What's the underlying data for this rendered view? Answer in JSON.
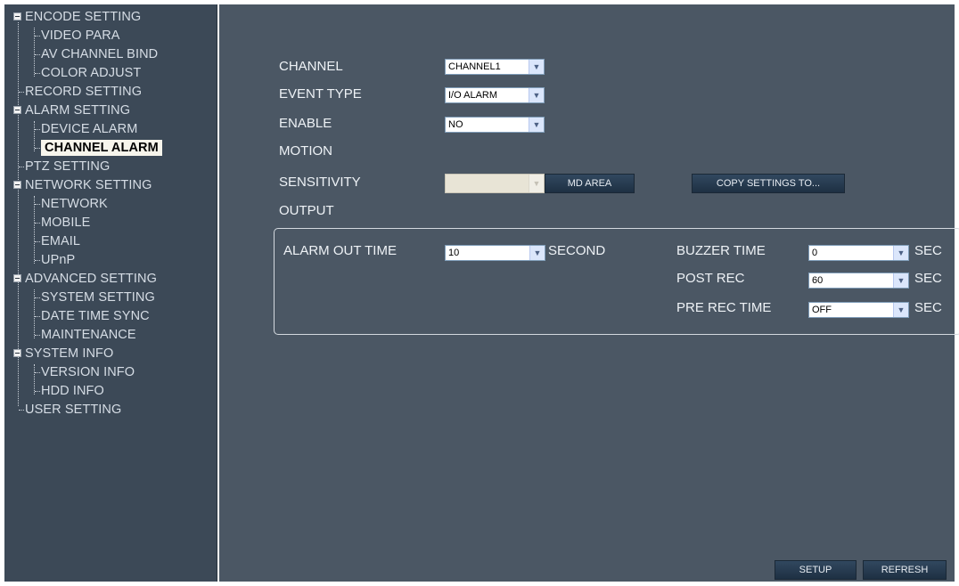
{
  "tree": {
    "items": [
      {
        "label": "ENCODE SETTING"
      },
      {
        "label": "VIDEO PARA"
      },
      {
        "label": "AV CHANNEL BIND"
      },
      {
        "label": "COLOR ADJUST"
      },
      {
        "label": "RECORD SETTING"
      },
      {
        "label": "ALARM SETTING"
      },
      {
        "label": "DEVICE ALARM"
      },
      {
        "label": "CHANNEL ALARM"
      },
      {
        "label": "PTZ SETTING"
      },
      {
        "label": "NETWORK SETTING"
      },
      {
        "label": "NETWORK"
      },
      {
        "label": "MOBILE"
      },
      {
        "label": "EMAIL"
      },
      {
        "label": "UPnP"
      },
      {
        "label": "ADVANCED SETTING"
      },
      {
        "label": "SYSTEM SETTING"
      },
      {
        "label": "DATE TIME SYNC"
      },
      {
        "label": "MAINTENANCE"
      },
      {
        "label": "SYSTEM INFO"
      },
      {
        "label": "VERSION INFO"
      },
      {
        "label": "HDD INFO"
      },
      {
        "label": "USER SETTING"
      }
    ]
  },
  "form": {
    "channel_label": "CHANNEL",
    "channel_value": "CHANNEL1",
    "event_type_label": "EVENT TYPE",
    "event_type_value": "I/O ALARM",
    "enable_label": "ENABLE",
    "enable_value": "NO",
    "motion_label": "MOTION",
    "sensitivity_label": "SENSITIVITY",
    "sensitivity_value": "",
    "md_area_button": "MD AREA",
    "copy_settings_button": "COPY SETTINGS TO...",
    "output_label": "OUTPUT"
  },
  "output": {
    "alarm_out_time_label": "ALARM OUT TIME",
    "alarm_out_time_value": "10",
    "alarm_out_time_unit": "SECOND",
    "buzzer_time_label": "BUZZER TIME",
    "buzzer_time_value": "0",
    "buzzer_time_unit": "SEC",
    "post_rec_label": "POST REC",
    "post_rec_value": "60",
    "post_rec_unit": "SEC",
    "pre_rec_time_label": "PRE REC TIME",
    "pre_rec_time_value": "OFF",
    "pre_rec_time_unit": "SEC"
  },
  "footer": {
    "setup_button": "SETUP",
    "refresh_button": "REFRESH"
  },
  "icons": {
    "dropdown": "chevron-down-icon",
    "expander": "collapse-icon"
  },
  "colors": {
    "sidebar_bg": "#3c4957",
    "main_bg": "#4b5764",
    "selected_bg": "#f7f5ec"
  }
}
